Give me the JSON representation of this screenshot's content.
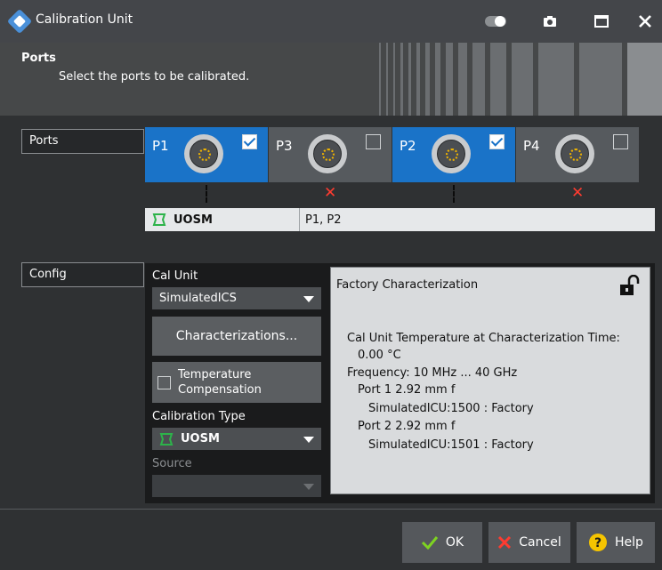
{
  "window": {
    "title": "Calibration Unit"
  },
  "header": {
    "title": "Ports",
    "subtitle": "Select the ports to be calibrated."
  },
  "sections": {
    "ports_label": "Ports",
    "config_label": "Config"
  },
  "ports": [
    {
      "label": "P1",
      "checked": true
    },
    {
      "label": "P3",
      "checked": false
    },
    {
      "label": "P2",
      "checked": true
    },
    {
      "label": "P4",
      "checked": false
    }
  ],
  "connection": {
    "type": "UOSM",
    "ports": "P1, P2"
  },
  "config": {
    "cal_unit_label": "Cal Unit",
    "cal_unit_value": "SimulatedICS",
    "characterizations_button": "Characterizations...",
    "temperature_label_line1": "Temperature",
    "temperature_label_line2": "Compensation",
    "calibration_type_label": "Calibration Type",
    "calibration_type_value": "UOSM",
    "source_label": "Source",
    "source_value": ""
  },
  "factory": {
    "title": "Factory Characterization",
    "lines": [
      "Cal Unit Temperature at Characterization Time:",
      "0.00 °C",
      "Frequency: 10 MHz ... 40 GHz",
      "Port 1 2.92 mm f",
      "SimulatedICU:1500 : Factory",
      "Port 2 2.92 mm f",
      "SimulatedICU:1501 : Factory"
    ]
  },
  "buttons": {
    "ok": "OK",
    "cancel": "Cancel",
    "help": "Help"
  },
  "colors": {
    "accent": "#1a73c8",
    "window_bg": "#2f3133",
    "error": "#ff3b30",
    "connection_icon": "#2db34a"
  }
}
